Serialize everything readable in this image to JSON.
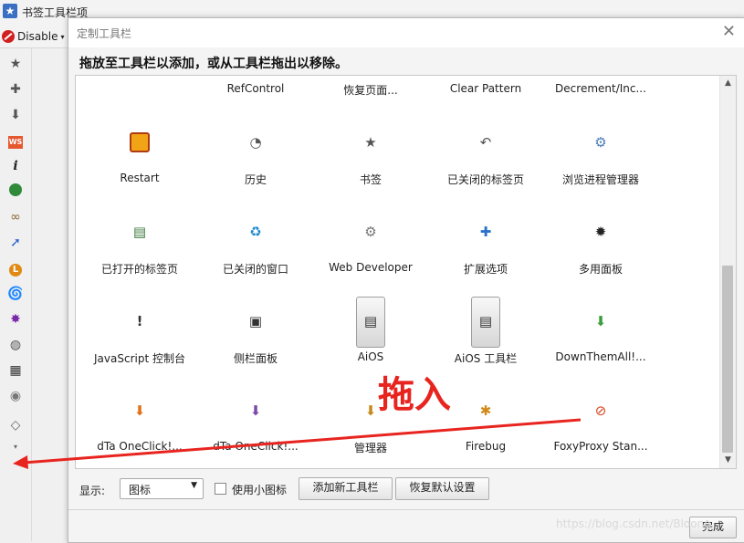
{
  "window": {
    "title": "书签工具栏项",
    "disable_label": "Disable"
  },
  "sidebar_icons": [
    "star-icon",
    "puzzle-icon",
    "download-arrow-icon",
    "ws-icon",
    "info-icon",
    "green-orb-icon",
    "chain-icon",
    "pointer-icon",
    "l-badge-icon",
    "swirl-icon",
    "burst-icon",
    "palette-icon",
    "grid-icon",
    "orb-menu-icon",
    "eraser-icon",
    "chevron-down-icon"
  ],
  "dialog": {
    "title": "定制工具栏",
    "instruction": "拖放至工具栏以添加，或从工具栏拖出以移除。",
    "items": [
      {
        "label": "RefControl"
      },
      {
        "label": "恢复页面..."
      },
      {
        "label": "Clear Pattern"
      },
      {
        "label": "Decrement/Inc..."
      },
      {
        "label": "Restart",
        "icon": "restart-icon"
      },
      {
        "label": "历史",
        "icon": "clock-icon"
      },
      {
        "label": "书签",
        "icon": "star-icon"
      },
      {
        "label": "已关闭的标签页",
        "icon": "undo-icon"
      },
      {
        "label": "浏览进程管理器",
        "icon": "process-manager-icon"
      },
      {
        "label": "已打开的标签页",
        "icon": "printer-icon"
      },
      {
        "label": "已关闭的窗口",
        "icon": "recycle-icon"
      },
      {
        "label": "Web Developer",
        "icon": "gear-icon"
      },
      {
        "label": "扩展选项",
        "icon": "puzzle-icon"
      },
      {
        "label": "多用面板",
        "icon": "sparkle-icon"
      },
      {
        "label": "JavaScript 控制台",
        "icon": "exclamation-icon"
      },
      {
        "label": "侧栏面板",
        "icon": "window-icon"
      },
      {
        "label": "AiOS",
        "icon": "sidebar-window-icon"
      },
      {
        "label": "AiOS 工具栏",
        "icon": "sidebar-window-icon"
      },
      {
        "label": "DownThemAll!...",
        "icon": "green-down-arrow-icon"
      },
      {
        "label": "dTa OneClick!...",
        "icon": "orange-down-arrow-icon"
      },
      {
        "label": "dTa OneClick!...",
        "icon": "purple-down-arrow-icon"
      },
      {
        "label": "管理器",
        "icon": "manager-box-icon"
      },
      {
        "label": "Firebug",
        "icon": "bug-icon"
      },
      {
        "label": "FoxyProxy Stan...",
        "icon": "proxy-disabled-icon"
      }
    ],
    "show_label": "显示:",
    "show_value": "图标",
    "small_icons_label": "使用小图标",
    "add_toolbar_label": "添加新工具栏",
    "restore_label": "恢复默认设置",
    "done_label": "完成"
  },
  "annotation": {
    "text": "拖入",
    "color": "#e8241f"
  },
  "watermark": "https://blog.csdn.net/Bloong"
}
